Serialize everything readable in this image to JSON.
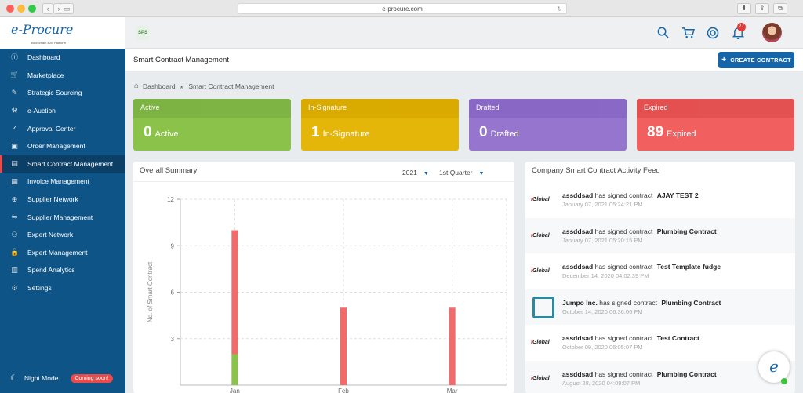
{
  "browser": {
    "url": "e-procure.com"
  },
  "app": {
    "logo_text": "e-Procure",
    "logo_tagline": "Blockchain B2B Platform",
    "org_logo": "SPS"
  },
  "sidebar": {
    "items": [
      {
        "label": "Dashboard",
        "icon": "info-circle-icon"
      },
      {
        "label": "Marketplace",
        "icon": "cart-icon"
      },
      {
        "label": "Strategic Sourcing",
        "icon": "pencil-icon"
      },
      {
        "label": "e-Auction",
        "icon": "gavel-icon"
      },
      {
        "label": "Approval Center",
        "icon": "check-circle-icon"
      },
      {
        "label": "Order Management",
        "icon": "box-icon"
      },
      {
        "label": "Smart Contract Management",
        "icon": "document-icon"
      },
      {
        "label": "Invoice Management",
        "icon": "invoice-icon"
      },
      {
        "label": "Supplier Network",
        "icon": "network-icon"
      },
      {
        "label": "Supplier Management",
        "icon": "handshake-icon"
      },
      {
        "label": "Expert Network",
        "icon": "experts-icon"
      },
      {
        "label": "Expert Management",
        "icon": "lock-icon"
      },
      {
        "label": "Spend Analytics",
        "icon": "chart-icon"
      },
      {
        "label": "Settings",
        "icon": "gear-icon"
      }
    ],
    "active_index": 6,
    "night_mode": {
      "label": "Night Mode",
      "badge": "Coming soon!"
    }
  },
  "topbar": {
    "notification_count": "27"
  },
  "page": {
    "title": "Smart Contract Management",
    "create_button": "CREATE CONTRACT",
    "breadcrumb": [
      "Dashboard",
      "Smart Contract Management"
    ]
  },
  "cards": [
    {
      "title": "Active",
      "count": "0",
      "label": "Active",
      "color": "#8bc34a",
      "head": "#7cb342"
    },
    {
      "title": "In-Signature",
      "count": "1",
      "label": "In-Signature",
      "color": "#e5b60a",
      "head": "#d9aa00"
    },
    {
      "title": "Drafted",
      "count": "0",
      "label": "Drafted",
      "color": "#9575cd",
      "head": "#8868c4"
    },
    {
      "title": "Expired",
      "count": "89",
      "label": "Expired",
      "color": "#f15f5f",
      "head": "#e35050"
    }
  ],
  "summary": {
    "title": "Overall Summary",
    "year": "2021",
    "quarter": "1st Quarter"
  },
  "chart_data": {
    "type": "bar",
    "stacked": true,
    "categories": [
      "Jan",
      "Feb",
      "Mar"
    ],
    "series": [
      {
        "values": [
          2,
          0,
          0
        ],
        "color": "#8bc34a"
      },
      {
        "values": [
          8,
          5,
          5
        ],
        "color": "#f16b6b"
      }
    ],
    "ylabel": "No. of Smart Contract",
    "ylim": [
      0,
      12
    ],
    "yticks": [
      3,
      6,
      9,
      12
    ],
    "grid": true
  },
  "feed": {
    "title": "Company Smart Contract Activity Feed",
    "items": [
      {
        "who": "assddsad",
        "action": "has signed contract",
        "what": "AJAY TEST 2",
        "when": "January 07, 2021 05:24:21 PM",
        "logo": "iGlobal"
      },
      {
        "who": "assddsad",
        "action": "has signed contract",
        "what": "Plumbing Contract",
        "when": "January 07, 2021 05:20:15 PM",
        "logo": "iGlobal"
      },
      {
        "who": "assddsad",
        "action": "has signed contract",
        "what": "Test Template fudge",
        "when": "December 14, 2020 04:02:39 PM",
        "logo": "iGlobal"
      },
      {
        "who": "Jumpo Inc.",
        "action": "has signed contract",
        "what": "Plumbing Contract",
        "when": "October 14, 2020 06:36:06 PM",
        "logo": "jumpo"
      },
      {
        "who": "assddsad",
        "action": "has signed contract",
        "what": "Test Contract",
        "when": "October 09, 2020 06:05:07 PM",
        "logo": "iGlobal"
      },
      {
        "who": "assddsad",
        "action": "has signed contract",
        "what": "Plumbing Contract",
        "when": "August 28, 2020 04:09:07 PM",
        "logo": "iGlobal"
      }
    ]
  }
}
